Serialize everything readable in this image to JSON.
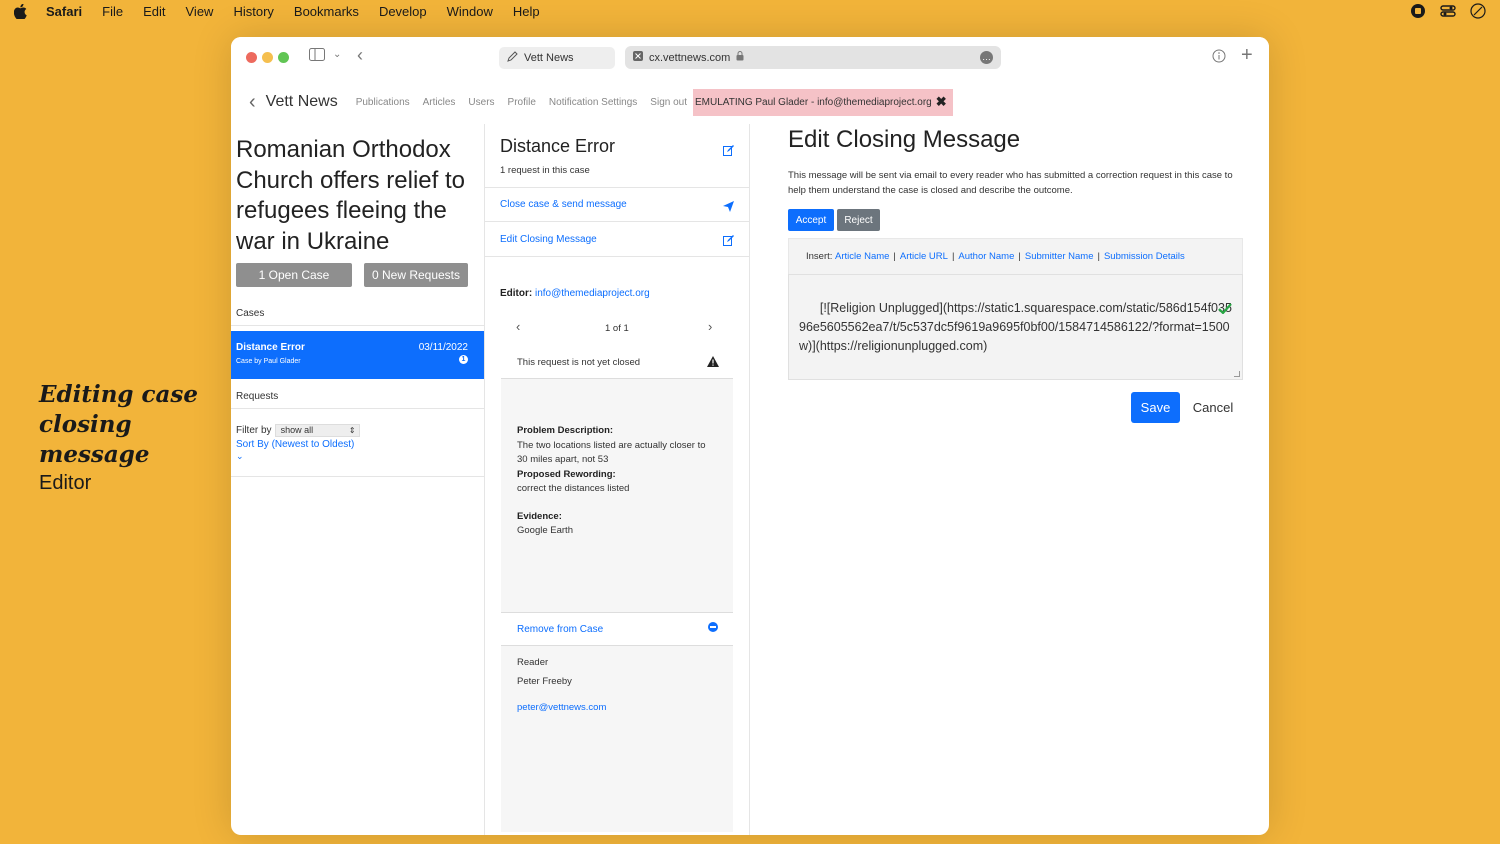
{
  "menubar": {
    "app": "Safari",
    "items": [
      "File",
      "Edit",
      "View",
      "History",
      "Bookmarks",
      "Develop",
      "Window",
      "Help"
    ]
  },
  "caption": {
    "title_line1": "Editing case",
    "title_line2": "closing message",
    "subtitle": "Editor"
  },
  "browser": {
    "tab_title": "Vett News",
    "url": "cx.vettnews.com"
  },
  "nav": {
    "brand": "Vett News",
    "links": [
      "Publications",
      "Articles",
      "Users",
      "Profile",
      "Notification Settings",
      "Sign out"
    ],
    "emulating": "EMULATING Paul Glader - info@themediaproject.org"
  },
  "left": {
    "headline": "Romanian Orthodox Church offers relief to refugees fleeing the war in Ukraine",
    "open_case_btn": "1 Open Case",
    "new_requests_btn": "0 New Requests",
    "cases_label": "Cases",
    "case": {
      "title": "Distance Error",
      "subtitle": "Case by Paul Glader",
      "date": "03/11/2022",
      "badge": "1"
    },
    "requests_label": "Requests",
    "filter_label": "Filter by",
    "filter_value": "show all",
    "sort_label": "Sort By (Newest to Oldest)"
  },
  "middle": {
    "title": "Distance Error",
    "subtitle": "1 request in this case",
    "close_link": "Close case & send message",
    "edit_link": "Edit Closing Message",
    "editor_label": "Editor:",
    "editor_email": "info@themediaproject.org",
    "pager": "1 of 1",
    "status": "This request is not yet closed",
    "problem_label": "Problem Description:",
    "problem_text": "The two locations listed are actually closer to 30 miles apart, not 53",
    "reword_label": "Proposed Rewording:",
    "reword_text": "correct the distances listed",
    "evidence_label": "Evidence:",
    "evidence_text": "Google Earth",
    "remove_link": "Remove from Case",
    "reader_label": "Reader",
    "reader_name": "Peter Freeby",
    "reader_email": "peter@vettnews.com"
  },
  "right": {
    "title": "Edit Closing Message",
    "description": "This message will be sent via email to every reader who has submitted a correction request in this case to help them understand the case is closed and describe the outcome.",
    "accept": "Accept",
    "reject": "Reject",
    "insert_label": "Insert:",
    "insert_links": [
      "Article Name",
      "Article URL",
      "Author Name",
      "Submitter Name",
      "Submission Details"
    ],
    "message": "[![Religion Unplugged](https://static1.squarespace.com/static/586d154f03596e5605562ea7/t/5c537dc5f9619a9695f0bf00/1584714586122/?format=1500w)](https://religionunplugged.com)",
    "save": "Save",
    "cancel": "Cancel"
  },
  "colors": {
    "background": "#F2B43A",
    "primary": "#0D6EFD",
    "emulate_bg": "#F5C2C7",
    "check": "#28A745"
  }
}
